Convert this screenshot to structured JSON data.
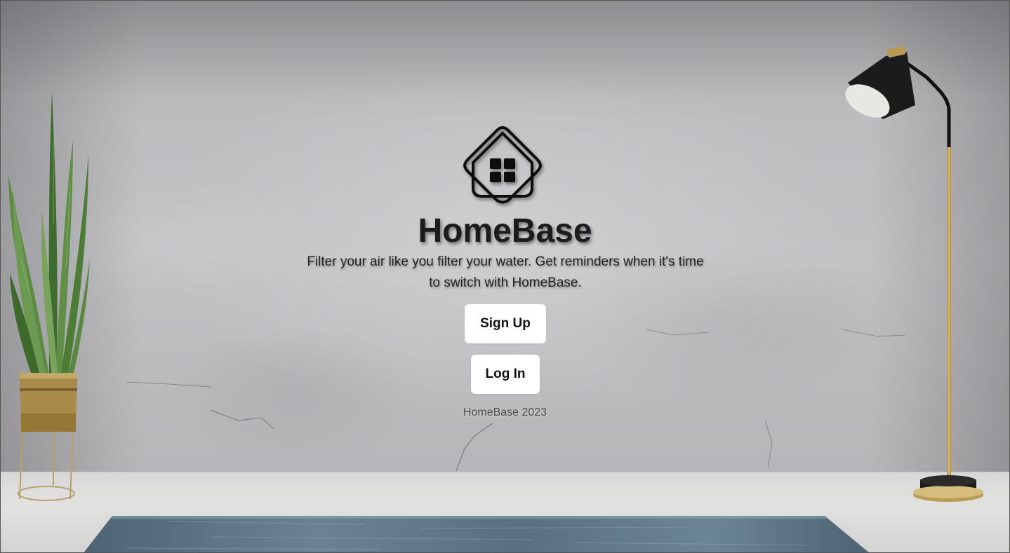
{
  "app": {
    "name": "HomeBase"
  },
  "hero": {
    "title": "HomeBase",
    "tagline": "Filter your air like you filter your water. Get reminders when it's time to switch with HomeBase.",
    "signup_label": "Sign Up",
    "login_label": "Log In",
    "footer": "HomeBase 2023"
  },
  "icons": {
    "logo": "house-logo-icon"
  },
  "colors": {
    "wall": "#bdbdc0",
    "floor": "#dcdcdb",
    "rug": "#5b7486",
    "button_bg": "#ffffff",
    "text": "#1c1c1c"
  }
}
